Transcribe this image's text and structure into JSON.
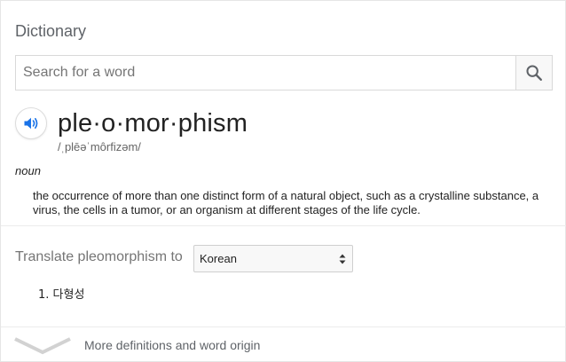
{
  "header": {
    "title": "Dictionary"
  },
  "search": {
    "placeholder": "Search for a word",
    "value": ""
  },
  "entry": {
    "word": "ple·o·mor·phism",
    "phonetic": "/ˌplēəˈmôrfizəm/",
    "part_of_speech": "noun",
    "definition": "the occurrence of more than one distinct form of a natural object, such as a crystalline substance, a virus, the cells in a tumor, or an organism at different stages of the life cycle."
  },
  "translate": {
    "label": "Translate pleomorphism to",
    "selected_language": "Korean",
    "results": [
      "1. 다형성"
    ]
  },
  "footer": {
    "more_label": "More definitions and word origin"
  },
  "colors": {
    "accent": "#1a73e8",
    "muted": "#757575"
  },
  "icons": {
    "search": "search-icon",
    "speaker": "speaker-icon",
    "more": "chevron-down-icon",
    "select": "updown-arrows-icon"
  }
}
